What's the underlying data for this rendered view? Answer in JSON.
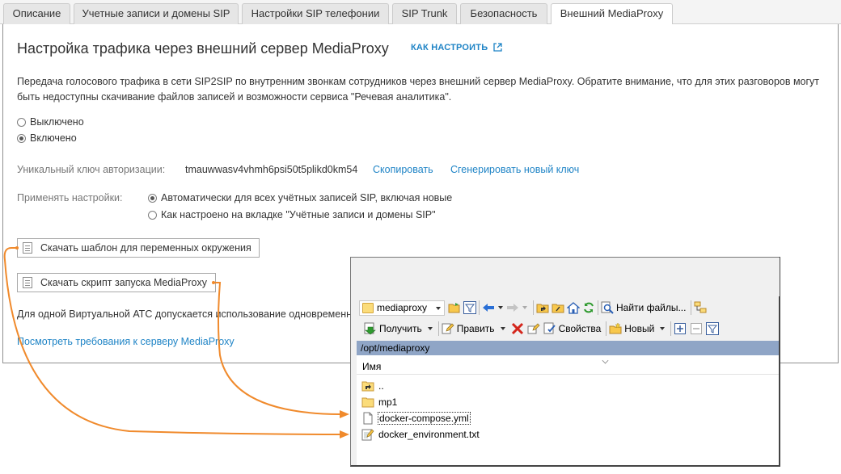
{
  "tabs": [
    {
      "label": "Описание",
      "active": false
    },
    {
      "label": "Учетные записи и домены SIP",
      "active": false
    },
    {
      "label": "Настройки SIP телефонии",
      "active": false
    },
    {
      "label": "SIP Trunk",
      "active": false
    },
    {
      "label": "Безопасность",
      "active": false
    },
    {
      "label": "Внешний MediaProxy",
      "active": true
    }
  ],
  "main": {
    "title": "Настройка трафика через внешний сервер MediaProxy",
    "howto_link": "КАК НАСТРОИТЬ",
    "description": "Передача голосового трафика в сети SIP2SIP по внутренним звонкам сотрудников через внешний сервер MediaProxy. Обратите внимание, что для этих разговоров могут быть недоступны скачивание файлов записей и возможности сервиса \"Речевая аналитика\".",
    "mode_options": [
      {
        "label": "Выключено",
        "checked": false
      },
      {
        "label": "Включено",
        "checked": true
      }
    ],
    "auth_key_label": "Уникальный ключ авторизации:",
    "auth_key_value": "tmauwwasv4vhmh6psi50t5plikd0km54",
    "copy_link": "Скопировать",
    "generate_link": "Сгенерировать новый ключ",
    "apply_label": "Применять настройки:",
    "apply_options": [
      {
        "label": "Автоматически для всех учётных записей SIP, включая новые",
        "checked": true
      },
      {
        "label": "Как настроено на вкладке \"Учётные записи и домены SIP\"",
        "checked": false
      }
    ],
    "download_env_button": "Скачать шаблон для переменных окружения",
    "download_script_button": "Скачать скрипт запуска MediaProxy",
    "note": "Для одной Виртуальной АТС допускается использование одновременн",
    "requirements_link": "Посмотреть требования к серверу MediaProxy"
  },
  "file_manager": {
    "folder_combo": "mediaproxy",
    "find_files": "Найти файлы...",
    "get_button": "Получить",
    "edit_button": "Править",
    "properties_button": "Свойства",
    "new_button": "Новый",
    "path": "/opt/mediaproxy",
    "column_name": "Имя",
    "files": [
      {
        "name": "..",
        "type": "parent"
      },
      {
        "name": "mp1",
        "type": "folder"
      },
      {
        "name": "docker-compose.yml",
        "type": "file"
      },
      {
        "name": "docker_environment.txt",
        "type": "text"
      }
    ]
  },
  "colors": {
    "link": "#1f84c6",
    "arrow": "#f08a2c",
    "path_bar": "#8fa5c6",
    "folder": "#fbdc7a"
  }
}
